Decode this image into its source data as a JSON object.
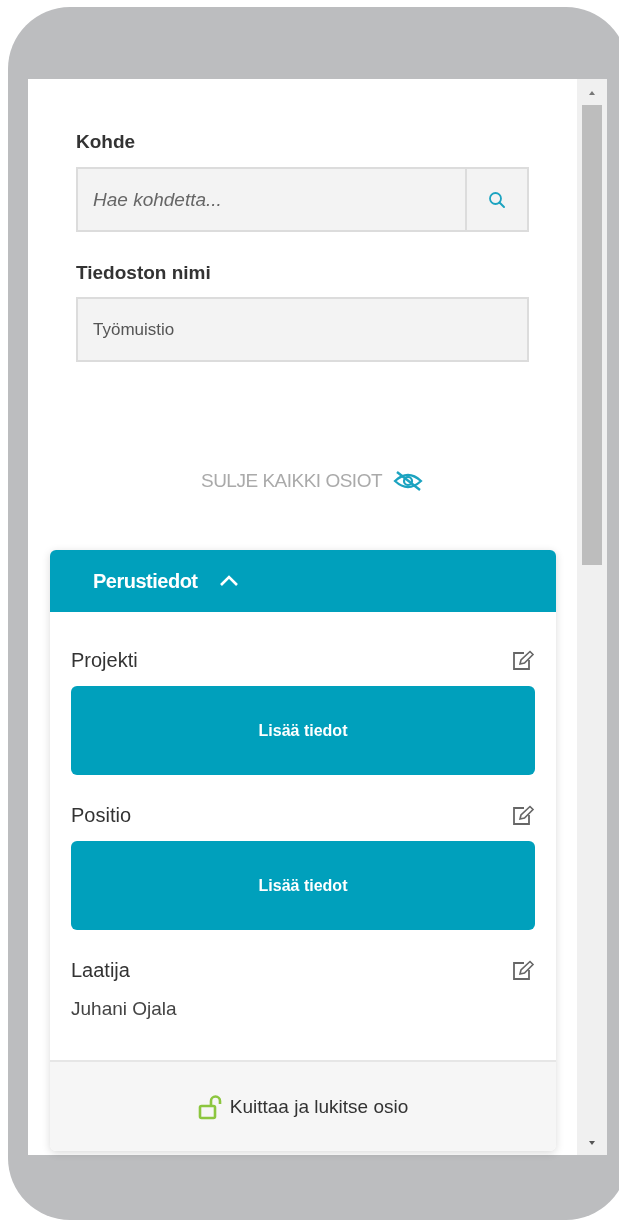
{
  "target": {
    "label": "Kohde",
    "placeholder": "Hae kohdetta..."
  },
  "file_name": {
    "label": "Tiedoston nimi",
    "value": "Työmuistio"
  },
  "collapse_all": {
    "label": "SULJE KAIKKI OSIOT"
  },
  "section": {
    "title": "Perustiedot",
    "expanded": true,
    "fields": [
      {
        "label": "Projekti",
        "kind": "button",
        "button": "Lisää tiedot"
      },
      {
        "label": "Positio",
        "kind": "button",
        "button": "Lisää tiedot"
      },
      {
        "label": "Laatija",
        "kind": "text",
        "value": "Juhani Ojala"
      }
    ],
    "footer": {
      "label": "Kuittaa ja lukitse osio",
      "locked": false
    }
  }
}
